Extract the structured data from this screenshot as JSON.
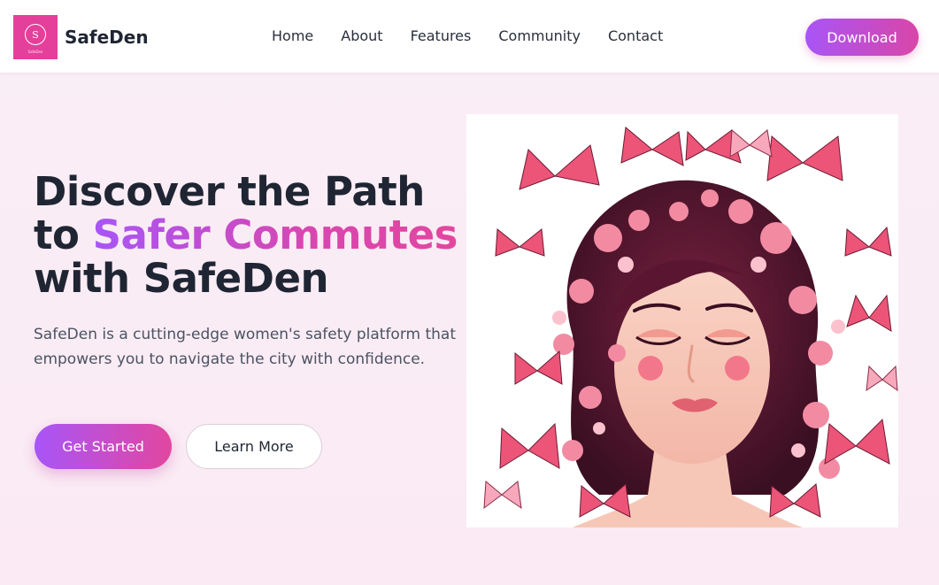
{
  "brand": {
    "name": "SafeDen",
    "logo_letter": "S",
    "logo_caption": "SafeDen"
  },
  "nav": {
    "links": [
      "Home",
      "About",
      "Features",
      "Community",
      "Contact"
    ],
    "download_label": "Download"
  },
  "hero": {
    "title_line1": "Discover the Path",
    "title_to": "to ",
    "title_accent": "Safer Commutes",
    "title_line3": "with SafeDen",
    "description": "SafeDen is a cutting-edge women's safety platform that empowers you to navigate the city with confidence.",
    "primary_cta": "Get Started",
    "secondary_cta": "Learn More"
  },
  "illustration": {
    "subject": "woman-with-butterflies-illustration"
  },
  "colors": {
    "brand_pink": "#e43f9a",
    "gradient_start": "#a855f7",
    "gradient_end": "#e2479f",
    "text_dark": "#1f2533",
    "text_body": "#4b5363"
  }
}
